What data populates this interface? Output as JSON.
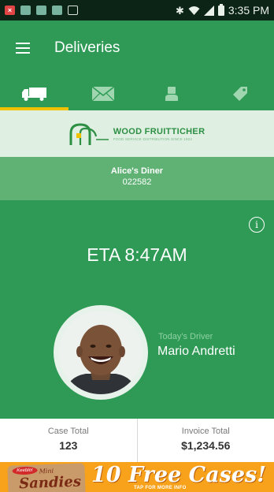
{
  "status_bar": {
    "time": "3:35 PM",
    "icons": [
      "close-notification-icon",
      "image-notification-icon",
      "image-notification-icon",
      "image-notification-icon",
      "gallery-notification-icon",
      "bluetooth-icon",
      "wifi-icon",
      "cell-signal-icon",
      "battery-icon"
    ]
  },
  "app_bar": {
    "title": "Deliveries",
    "menu_icon": "hamburger-menu-icon"
  },
  "tabs": [
    {
      "icon": "truck-icon",
      "active": true
    },
    {
      "icon": "mail-icon",
      "active": false
    },
    {
      "icon": "person-icon",
      "active": false
    },
    {
      "icon": "tag-icon",
      "active": false
    }
  ],
  "logo": {
    "name": "WOOD FRUITTICHER",
    "tagline": "FOOD SERVICE DISTRIBUTION SINCE 1922"
  },
  "customer": {
    "name": "Alice's Diner",
    "id": "022582"
  },
  "delivery": {
    "eta": "ETA 8:47AM",
    "driver_label": "Today's Driver",
    "driver_name": "Mario Andretti"
  },
  "totals": {
    "case_label": "Case Total",
    "case_value": "123",
    "invoice_label": "Invoice Total",
    "invoice_value": "$1,234.56"
  },
  "ad": {
    "brand": "Keebler",
    "product_line": "Mini",
    "product_name": "Sandies",
    "headline": "10 Free Cases!",
    "subtext": "TAP FOR MORE INFO"
  },
  "colors": {
    "primary_green": "#2e9a55",
    "customer_band": "#5fb274",
    "logo_band": "#dff0e2",
    "tab_indicator": "#f2c200",
    "ad_background": "#f8a21b"
  }
}
